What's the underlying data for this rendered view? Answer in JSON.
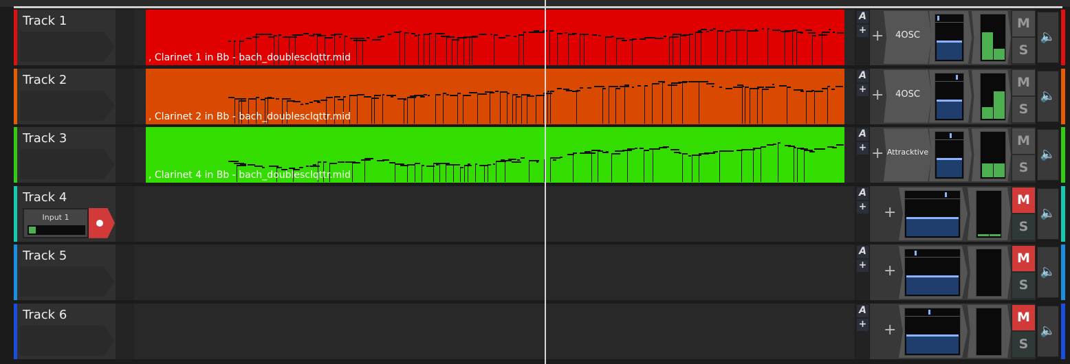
{
  "colors": {
    "clip_red": "#e00000",
    "clip_orange": "#d94a00",
    "clip_green": "#33dd00"
  },
  "tracks": [
    {
      "name": "Track 1",
      "color": "#e01010",
      "clip": {
        "label": ", Clarinet 1 in Bb - bach_doublesclqttr.mid",
        "color": "#e00000"
      },
      "plugin": "4OSC",
      "meter": [
        0.6,
        0.25
      ],
      "muted": false,
      "pan": 0.1
    },
    {
      "name": "Track 2",
      "color": "#e65c00",
      "clip": {
        "label": ", Clarinet 2 in Bb - bach_doublesclqttr.mid",
        "color": "#d94a00"
      },
      "plugin": "4OSC",
      "meter": [
        0.25,
        0.6
      ],
      "muted": false,
      "pan": 0.85
    },
    {
      "name": "Track 3",
      "color": "#33cc11",
      "clip": {
        "label": ", Clarinet 4 in Bb - bach_doublesclqttr.mid",
        "color": "#33dd00"
      },
      "plugin": "Attracktive",
      "meter": [
        0.3,
        0.3
      ],
      "muted": false,
      "pan": 0.6
    },
    {
      "name": "Track 4",
      "color": "#13c9b0",
      "input": "Input 1",
      "meter": [
        0.05,
        0.05
      ],
      "muted": true,
      "pan": 0.85
    },
    {
      "name": "Track 5",
      "color": "#1a8fe0",
      "meter": [
        0,
        0
      ],
      "muted": true,
      "pan": 0.2
    },
    {
      "name": "Track 6",
      "color": "#1a4ee0",
      "meter": [
        0,
        0
      ],
      "muted": true,
      "pan": 0.5
    }
  ],
  "labels": {
    "automation": "A",
    "add": "+",
    "mute": "M",
    "solo": "S",
    "speaker": "🔈"
  },
  "icons": {
    "record": "record-icon",
    "speaker": "speaker-icon",
    "add": "plus-icon"
  }
}
